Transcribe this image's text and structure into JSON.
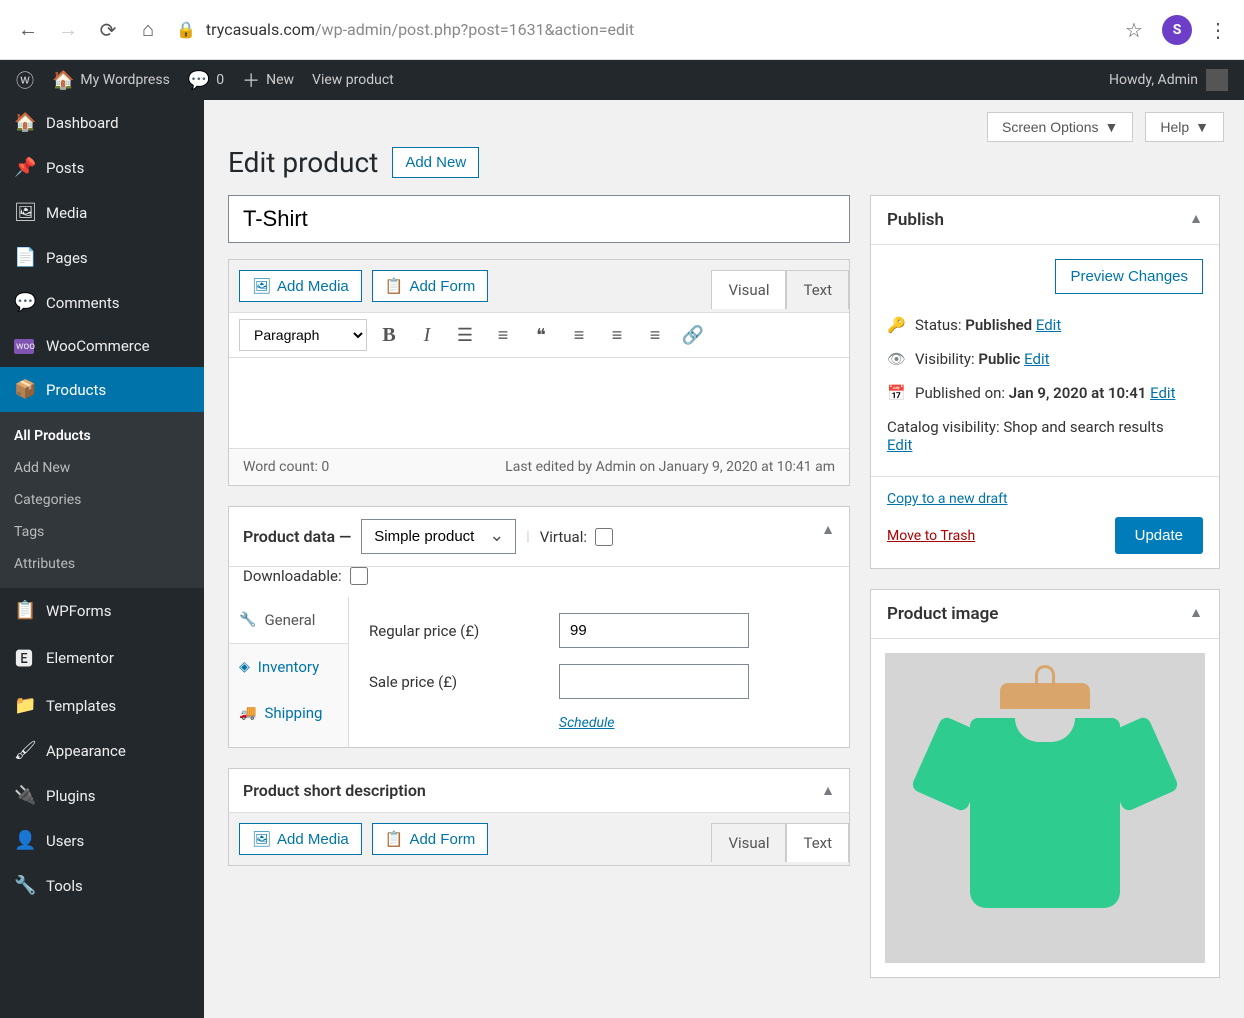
{
  "browser": {
    "url_domain": "trycasuals.com",
    "url_path": "/wp-admin/post.php?post=1631&action=edit",
    "avatar_letter": "S"
  },
  "adminbar": {
    "site_name": "My Wordpress",
    "comments_count": "0",
    "new_label": "New",
    "view_label": "View product",
    "howdy": "Howdy, Admin"
  },
  "sidebar": {
    "items": [
      {
        "label": "Dashboard"
      },
      {
        "label": "Posts"
      },
      {
        "label": "Media"
      },
      {
        "label": "Pages"
      },
      {
        "label": "Comments"
      },
      {
        "label": "WooCommerce"
      },
      {
        "label": "Products"
      },
      {
        "label": "WPForms"
      },
      {
        "label": "Elementor"
      },
      {
        "label": "Templates"
      },
      {
        "label": "Appearance"
      },
      {
        "label": "Plugins"
      },
      {
        "label": "Users"
      },
      {
        "label": "Tools"
      }
    ],
    "submenu": [
      {
        "label": "All Products"
      },
      {
        "label": "Add New"
      },
      {
        "label": "Categories"
      },
      {
        "label": "Tags"
      },
      {
        "label": "Attributes"
      }
    ]
  },
  "topbuttons": {
    "screen_options": "Screen Options",
    "help": "Help"
  },
  "page": {
    "title": "Edit product",
    "add_new": "Add New",
    "product_title": "T-Shirt"
  },
  "editor": {
    "add_media": "Add Media",
    "add_form": "Add Form",
    "tab_visual": "Visual",
    "tab_text": "Text",
    "format_select": "Paragraph",
    "word_count": "Word count: 0",
    "last_edited": "Last edited by Admin on January 9, 2020 at 10:41 am"
  },
  "product_data": {
    "header_label": "Product data —",
    "type": "Simple product",
    "virtual_label": "Virtual:",
    "downloadable_label": "Downloadable:",
    "tabs": {
      "general": "General",
      "inventory": "Inventory",
      "shipping": "Shipping"
    },
    "regular_price_label": "Regular price (£)",
    "regular_price_value": "99",
    "sale_price_label": "Sale price (£)",
    "sale_price_value": "",
    "schedule": "Schedule"
  },
  "short_desc": {
    "title": "Product short description",
    "add_media": "Add Media",
    "add_form": "Add Form",
    "tab_visual": "Visual",
    "tab_text": "Text"
  },
  "publish": {
    "title": "Publish",
    "preview": "Preview Changes",
    "status_label": "Status:",
    "status_value": "Published",
    "visibility_label": "Visibility:",
    "visibility_value": "Public",
    "published_label": "Published on:",
    "published_value": "Jan 9, 2020 at 10:41",
    "catalog_label": "Catalog visibility:",
    "catalog_value": "Shop and search results",
    "edit": "Edit",
    "copy": "Copy to a new draft",
    "trash": "Move to Trash",
    "update": "Update"
  },
  "product_image": {
    "title": "Product image"
  }
}
